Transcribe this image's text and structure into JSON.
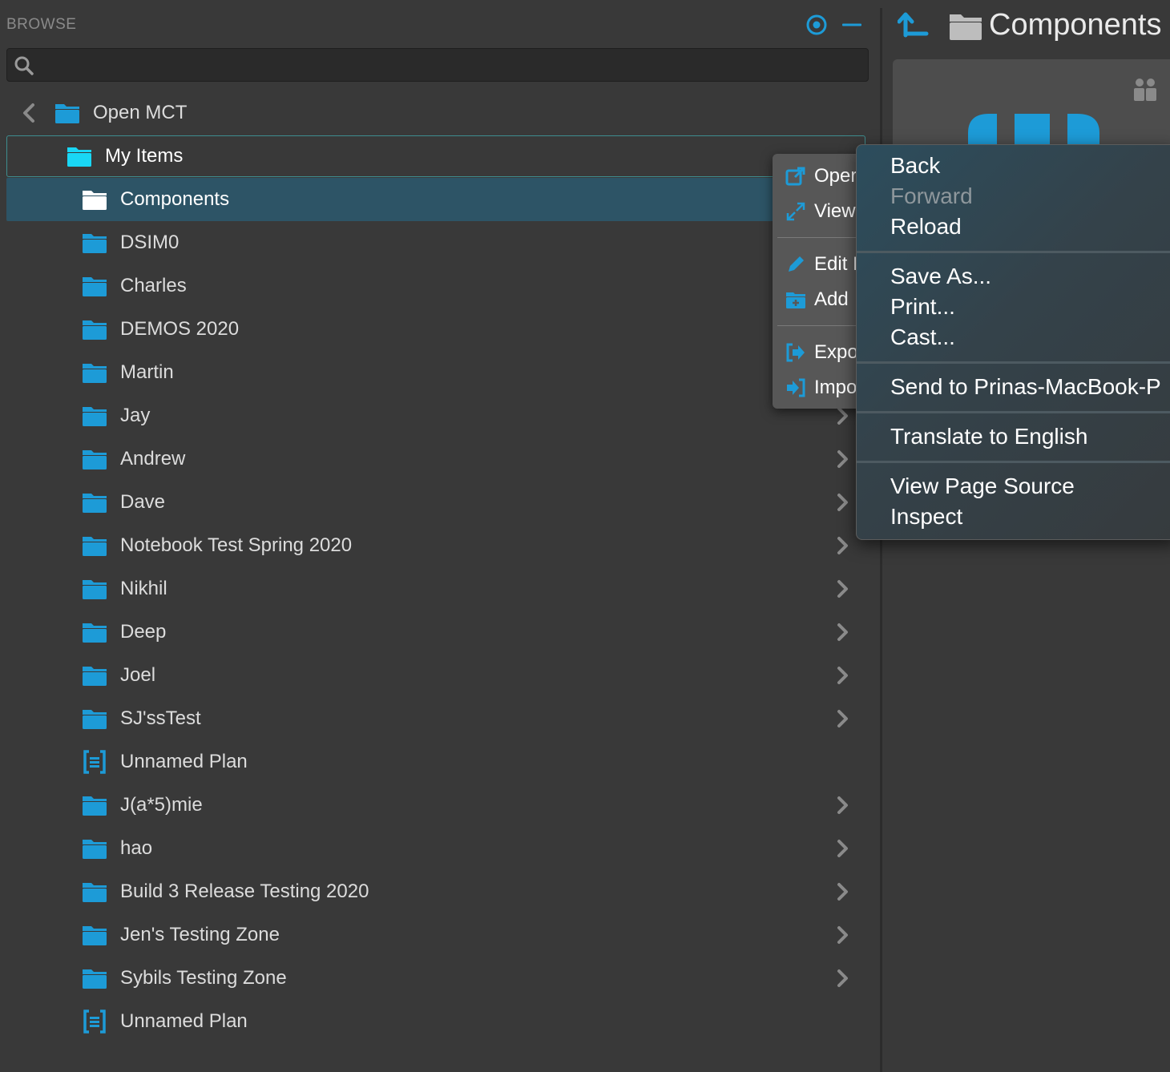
{
  "browse": {
    "title": "BROWSE",
    "search_placeholder": ""
  },
  "tree": {
    "root_label": "Open MCT",
    "my_items_label": "My Items",
    "items": [
      {
        "label": "Components",
        "type": "folder",
        "selected": true,
        "expandable": false
      },
      {
        "label": "DSIM0",
        "type": "folder",
        "expandable": false
      },
      {
        "label": "Charles",
        "type": "folder",
        "expandable": false
      },
      {
        "label": "DEMOS 2020",
        "type": "folder",
        "expandable": false
      },
      {
        "label": "Martin",
        "type": "folder",
        "expandable": false
      },
      {
        "label": "Jay",
        "type": "folder",
        "expandable": true
      },
      {
        "label": "Andrew",
        "type": "folder",
        "expandable": true
      },
      {
        "label": "Dave",
        "type": "folder",
        "expandable": true
      },
      {
        "label": "Notebook Test Spring 2020",
        "type": "folder",
        "expandable": true
      },
      {
        "label": "Nikhil",
        "type": "folder",
        "expandable": true
      },
      {
        "label": "Deep",
        "type": "folder",
        "expandable": true
      },
      {
        "label": "Joel",
        "type": "folder",
        "expandable": true
      },
      {
        "label": "SJ'ssTest",
        "type": "folder",
        "expandable": true
      },
      {
        "label": "Unnamed Plan",
        "type": "plan",
        "expandable": false
      },
      {
        "label": "J(a*5)mie",
        "type": "folder",
        "expandable": true
      },
      {
        "label": "hao",
        "type": "folder",
        "expandable": true
      },
      {
        "label": "Build 3 Release Testing 2020",
        "type": "folder",
        "expandable": true
      },
      {
        "label": "Jen's Testing Zone",
        "type": "folder",
        "expandable": true
      },
      {
        "label": "Sybils Testing Zone",
        "type": "folder",
        "expandable": true
      },
      {
        "label": "Unnamed Plan",
        "type": "plan",
        "expandable": false
      }
    ]
  },
  "right_pane": {
    "title": "Components"
  },
  "context_menu": {
    "items": [
      {
        "label": "Oper",
        "icon": "open-new-tab-icon"
      },
      {
        "label": "View",
        "icon": "expand-icon"
      },
      {
        "label": "Edit I",
        "icon": "pencil-icon"
      },
      {
        "label": "Add",
        "icon": "folder-add-icon"
      },
      {
        "label": "Expo",
        "icon": "export-icon"
      },
      {
        "label": "Impo",
        "icon": "import-icon"
      }
    ]
  },
  "browser_menu": {
    "back": "Back",
    "forward": "Forward",
    "reload": "Reload",
    "save_as": "Save As...",
    "print": "Print...",
    "cast": "Cast...",
    "send_to": "Send to Prinas-MacBook-P",
    "translate": "Translate to English",
    "view_source": "View Page Source",
    "inspect": "Inspect"
  },
  "colors": {
    "accent": "#1d9bd7",
    "accent_bright": "#19d7f5",
    "background": "#393939",
    "selected_row": "#2d5466"
  }
}
